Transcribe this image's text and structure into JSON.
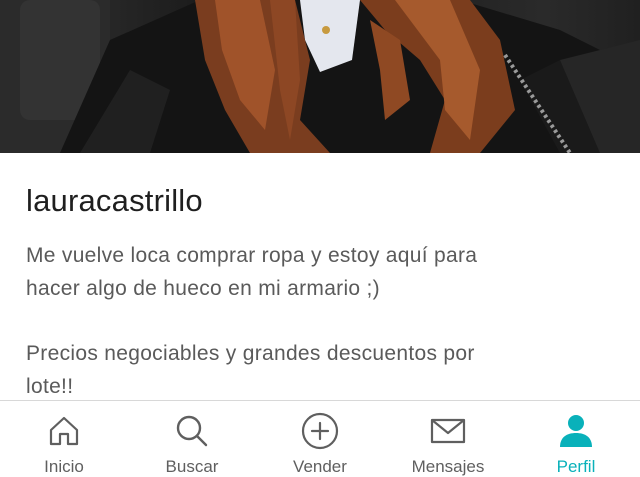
{
  "profile": {
    "username": "lauracastrillo",
    "bio_lines": [
      "Me vuelve loca comprar ropa y estoy aquí para",
      "hacer algo de hueco en mi armario ;)",
      "",
      "Precios negociables y grandes descuentos por",
      "lote!!"
    ]
  },
  "tabbar": {
    "items": [
      {
        "label": "Inicio",
        "icon": "home-icon"
      },
      {
        "label": "Buscar",
        "icon": "search-icon"
      },
      {
        "label": "Vender",
        "icon": "plus-circle-icon"
      },
      {
        "label": "Mensajes",
        "icon": "mail-icon"
      },
      {
        "label": "Perfil",
        "icon": "person-icon",
        "active": true
      }
    ]
  },
  "colors": {
    "accent": "#09b1ba",
    "inactive": "#5f5f5f",
    "text": "#1f1f1f"
  }
}
